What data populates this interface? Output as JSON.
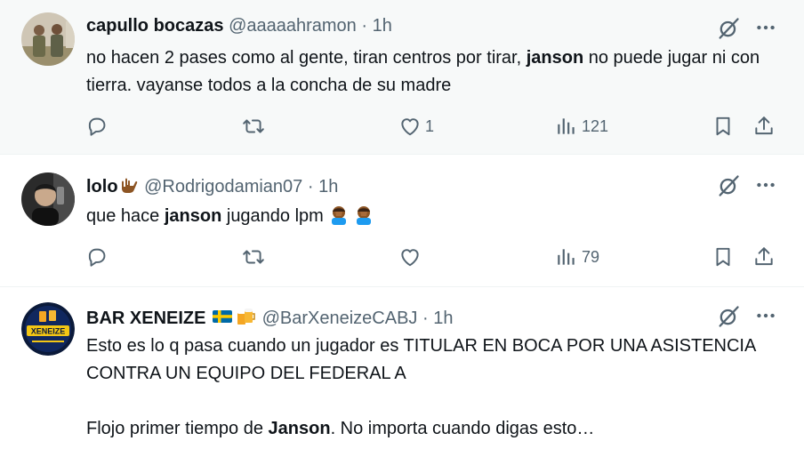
{
  "tweets": [
    {
      "name": "capullo bocazas",
      "handle": "@aaaaahramon",
      "dot": "·",
      "time": "1h",
      "text": [
        {
          "t": "no hacen 2 pases como al gente, tiran centros por tirar, "
        },
        {
          "t": "janson",
          "bold": true
        },
        {
          "t": " no puede jugar ni con tierra. vayanse todos a la concha de su madre"
        }
      ],
      "replies": "",
      "retweets": "",
      "likes": "1",
      "views": "121",
      "avatar": "soldiers-photo-avatar"
    },
    {
      "name": "lolo",
      "name_emoji": "call-me-hand-emoji",
      "handle": "@Rodrigodamian07",
      "dot": "·",
      "time": "1h",
      "text": [
        {
          "t": "que hace "
        },
        {
          "t": "janson",
          "bold": true
        },
        {
          "t": " jugando lpm "
        }
      ],
      "text_emojis": [
        "facepalm-emoji",
        "facepalm-emoji"
      ],
      "replies": "",
      "retweets": "",
      "likes": "",
      "views": "79",
      "avatar": "selfie-photo-avatar"
    },
    {
      "name": "BAR XENEIZE",
      "name_emojis": [
        "sweden-flag-emoji",
        "beer-mugs-emoji"
      ],
      "handle": "@BarXeneizeCABJ",
      "dot": "·",
      "time": "1h",
      "text_line1": "Esto es lo q pasa cuando un jugador es TITULAR EN BOCA POR UNA ASISTENCIA CONTRA UN EQUIPO DEL FEDERAL A",
      "text_line2": [
        {
          "t": "Flojo primer tiempo de "
        },
        {
          "t": "Janson",
          "bold": true
        },
        {
          "t": ". No importa cuando digas esto…"
        }
      ],
      "avatar": "bar-xeneize-logo-avatar",
      "avatar_text": "XENEIZE"
    }
  ],
  "colors": {
    "text": "#0f1419",
    "secondary": "#536471",
    "highlight_bg": "#f7f9f9",
    "divider": "#eff3f4"
  },
  "icons": [
    "reply-icon",
    "retweet-icon",
    "like-icon",
    "views-icon",
    "bookmark-icon",
    "share-icon",
    "grok-icon",
    "more-icon"
  ]
}
